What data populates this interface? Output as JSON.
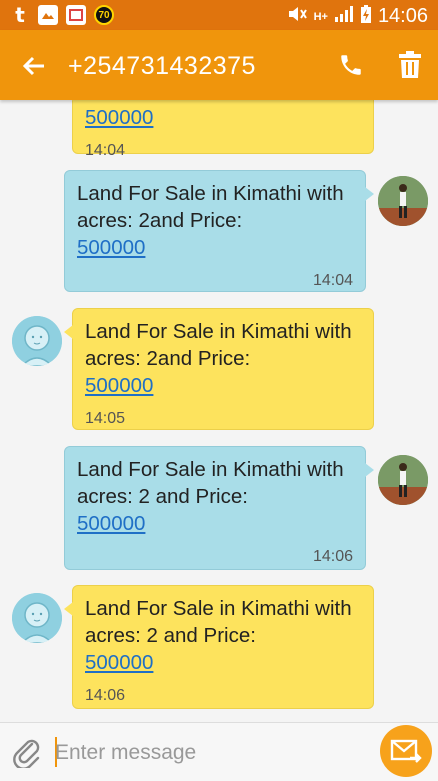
{
  "status_bar": {
    "time": "14:06",
    "network": "H+",
    "badge": "70"
  },
  "header": {
    "title": "+254731432375"
  },
  "messages": [
    {
      "direction": "in",
      "text": "",
      "link": "500000",
      "time": "14:04"
    },
    {
      "direction": "out",
      "text": "Land For Sale in Kimathi with acres: 2and Price:",
      "link": "500000",
      "time": "14:04"
    },
    {
      "direction": "in",
      "text": "Land For Sale in Kimathi with acres: 2and Price:",
      "link": "500000",
      "time": "14:05"
    },
    {
      "direction": "out",
      "text": "Land For Sale in Kimathi with acres: 2 and Price:",
      "link": "500000",
      "time": "14:06"
    },
    {
      "direction": "in",
      "text": "Land For Sale in Kimathi with acres: 2 and Price:",
      "link": "500000",
      "time": "14:06"
    }
  ],
  "composer": {
    "placeholder": "Enter message"
  },
  "colors": {
    "status_bar": "#e0740d",
    "app_bar": "#f0950c",
    "sent_bubble": "#a9dde8",
    "received_bubble": "#fde35d",
    "link": "#1f6fc6",
    "send_button": "#f7a21b"
  },
  "icons": [
    "back-arrow-icon",
    "phone-icon",
    "trash-icon",
    "paperclip-icon",
    "send-envelope-icon"
  ]
}
